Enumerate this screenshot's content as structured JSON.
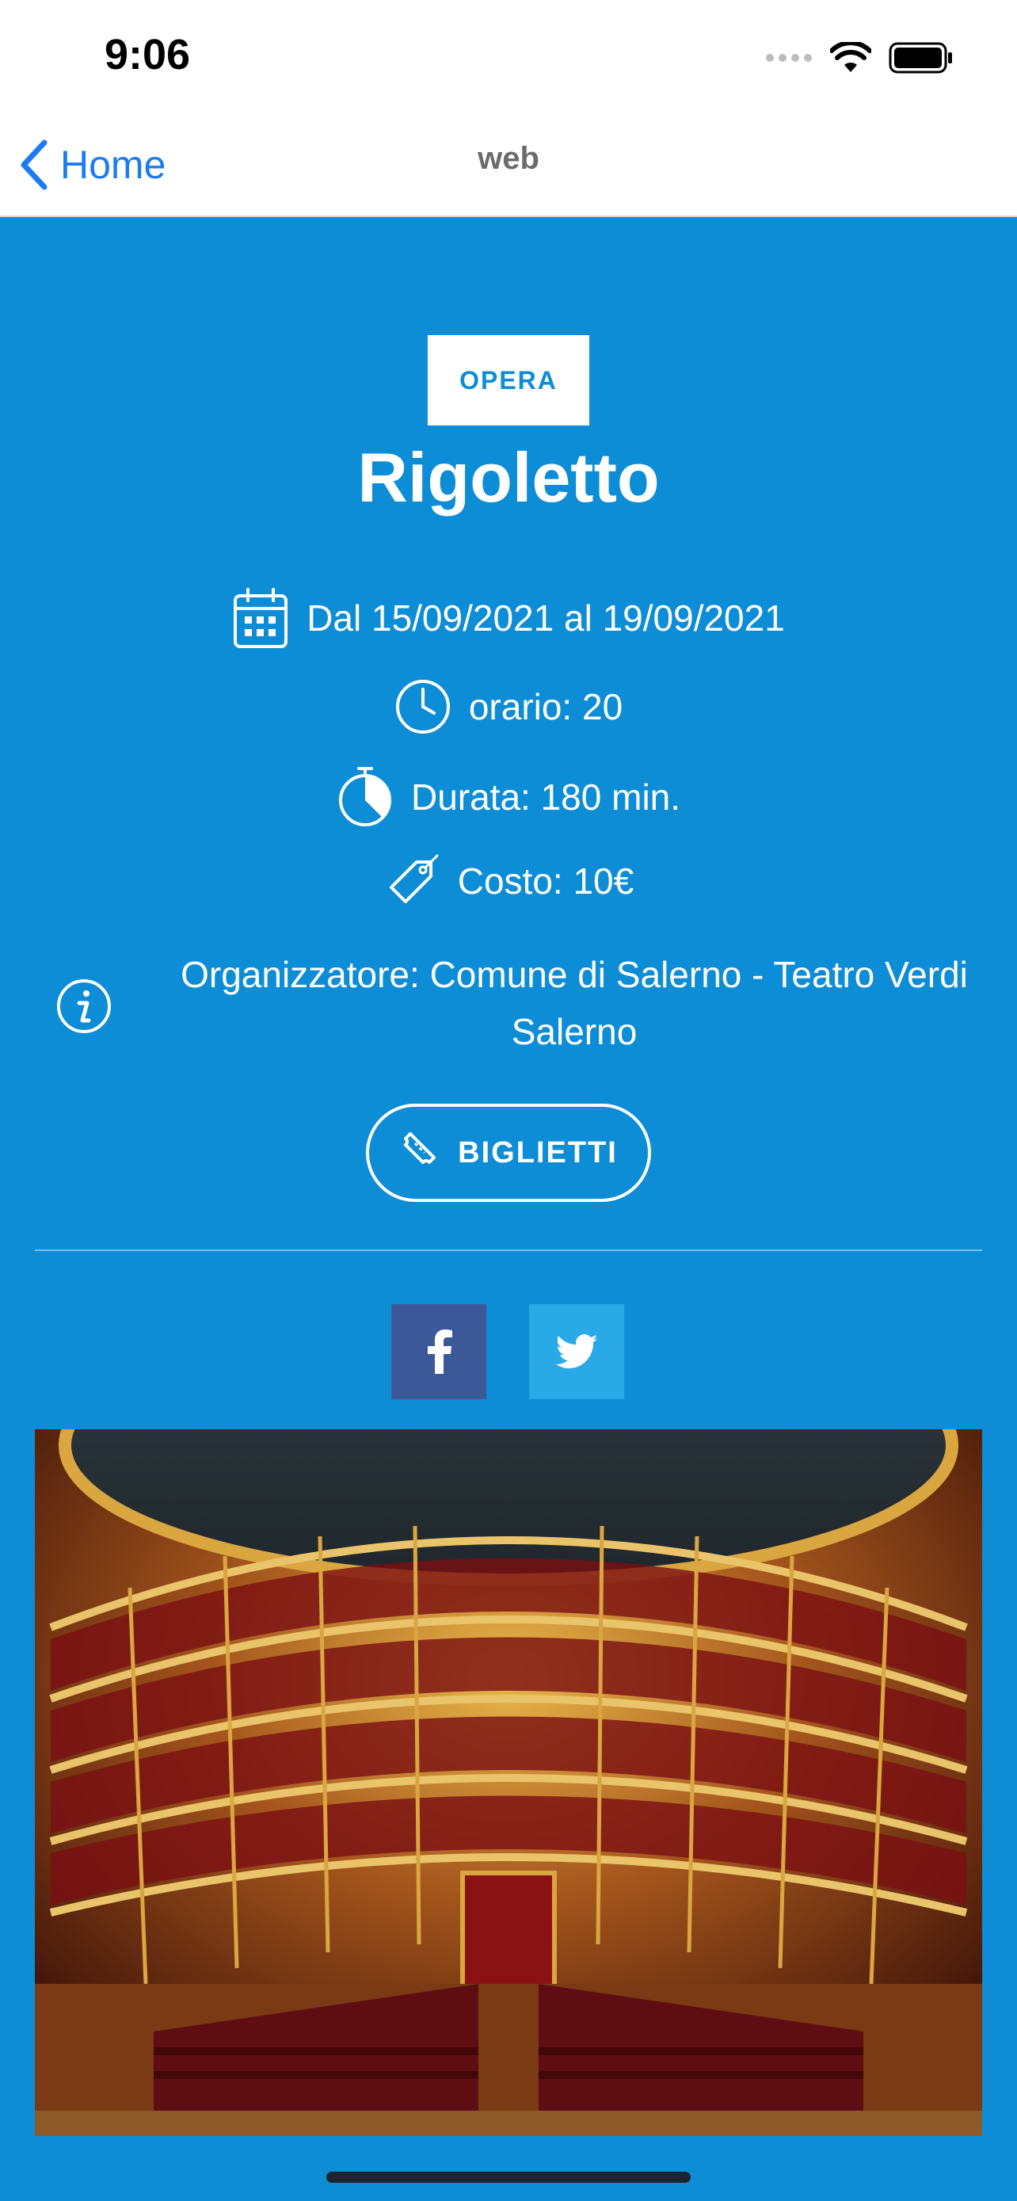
{
  "status": {
    "time": "9:06"
  },
  "nav": {
    "back_label": "Home",
    "title": "web"
  },
  "event": {
    "category": "OPERA",
    "title": "Rigoletto",
    "dates": "Dal 15/09/2021 al 19/09/2021",
    "time": "orario: 20",
    "duration": "Durata: 180 min.",
    "cost": "Costo: 10€",
    "organizer": "Organizzatore: Comune di Salerno - Teatro Verdi Salerno",
    "tickets_label": "BIGLIETTI"
  },
  "share": {
    "facebook_icon": "facebook-icon",
    "twitter_icon": "twitter-icon"
  },
  "colors": {
    "background": "#0d8dd6",
    "accent_link": "#1a7cf0",
    "facebook": "#3b5998",
    "twitter": "#29a9e6"
  }
}
